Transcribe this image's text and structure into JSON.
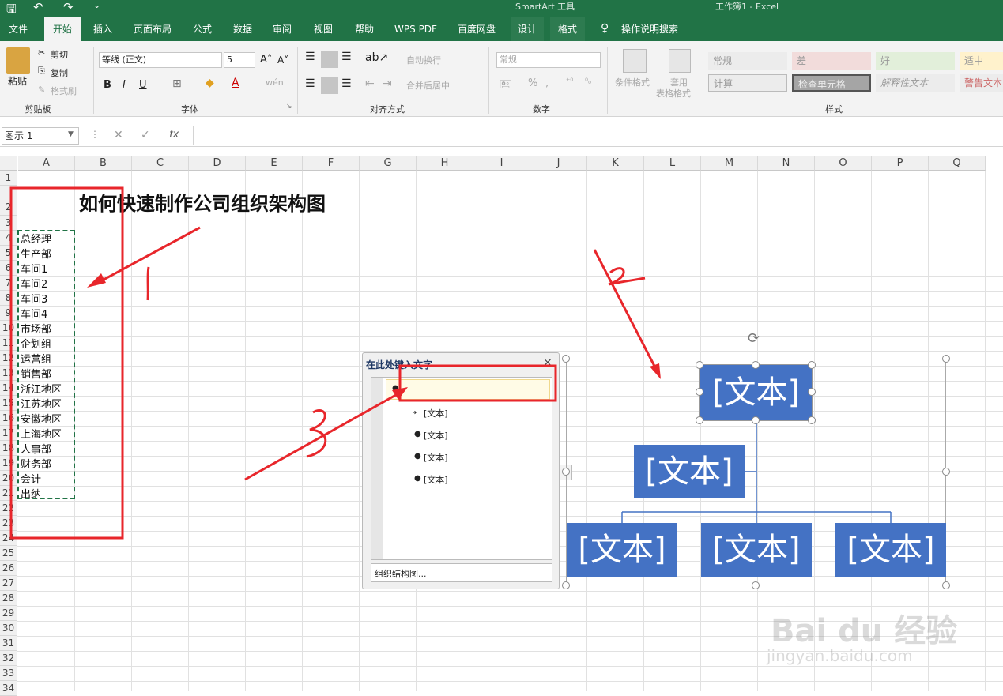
{
  "titlebar": {
    "context_tool": "SmartArt 工具",
    "doc_title": "工作簿1  -  Excel"
  },
  "tabs": [
    "文件",
    "开始",
    "插入",
    "页面布局",
    "公式",
    "数据",
    "审阅",
    "视图",
    "帮助",
    "WPS PDF",
    "百度网盘",
    "设计",
    "格式",
    "操作说明搜索"
  ],
  "ribbon": {
    "clipboard": {
      "paste": "粘贴",
      "cut": "剪切",
      "copy": "复制",
      "format_painter": "格式刷",
      "label": "剪贴板"
    },
    "font": {
      "font_name": "等线 (正文)",
      "font_size": "5",
      "bold": "B",
      "italic": "I",
      "underline": "U",
      "label": "字体"
    },
    "align": {
      "wrap": "自动换行",
      "merge": "合并后居中",
      "label": "对齐方式"
    },
    "number": {
      "format": "常规",
      "percent": "%",
      "label": "数字"
    },
    "styles": {
      "cond_format": "条件格式",
      "table_format_1": "套用",
      "table_format_2": "表格格式",
      "label": "样式",
      "cells": [
        "常规",
        "差",
        "好",
        "适中",
        "计算",
        "检查单元格",
        "解释性文本",
        "警告文本"
      ]
    }
  },
  "formula_bar": {
    "name_box": "图示 1",
    "fx": "fx"
  },
  "columns": [
    "A",
    "B",
    "C",
    "D",
    "E",
    "F",
    "G",
    "H",
    "I",
    "J",
    "K",
    "L",
    "M",
    "N",
    "O",
    "P",
    "Q"
  ],
  "rows": [
    "1",
    "2",
    "3",
    "4",
    "5",
    "6",
    "7",
    "8",
    "9",
    "10",
    "11",
    "12",
    "13",
    "14",
    "15",
    "16",
    "17",
    "18",
    "19",
    "20",
    "21",
    "22",
    "23",
    "24",
    "25",
    "26",
    "27",
    "28",
    "29",
    "30",
    "31",
    "32",
    "33",
    "34"
  ],
  "sheet": {
    "title": "如何快速制作公司组织架构图",
    "list": [
      "总经理",
      "生产部",
      "车间1",
      "车间2",
      "车间3",
      "车间4",
      "市场部",
      "企划组",
      "运营组",
      "销售部",
      "浙江地区",
      "江苏地区",
      "安徽地区",
      "上海地区",
      "人事部",
      "财务部",
      "会计",
      "出纳"
    ]
  },
  "text_pane": {
    "title": "在此处键入文字",
    "close": "×",
    "items": [
      "[文本]",
      "[文本]",
      "[文本]",
      "[文本]"
    ],
    "footer": "组织结构图..."
  },
  "smartart": {
    "boxes": [
      "[文本]",
      "[文本]",
      "[文本]",
      "[文本]",
      "[文本]"
    ]
  },
  "annotations": {
    "mark1": "1",
    "mark2": "2",
    "mark3": "3"
  },
  "watermark": {
    "brand": "Bai du 经验",
    "url": "jingyan.baidu.com"
  },
  "colors": {
    "excel_green": "#217346",
    "smartart_blue": "#4472c4",
    "annotation_red": "#e8262b"
  }
}
